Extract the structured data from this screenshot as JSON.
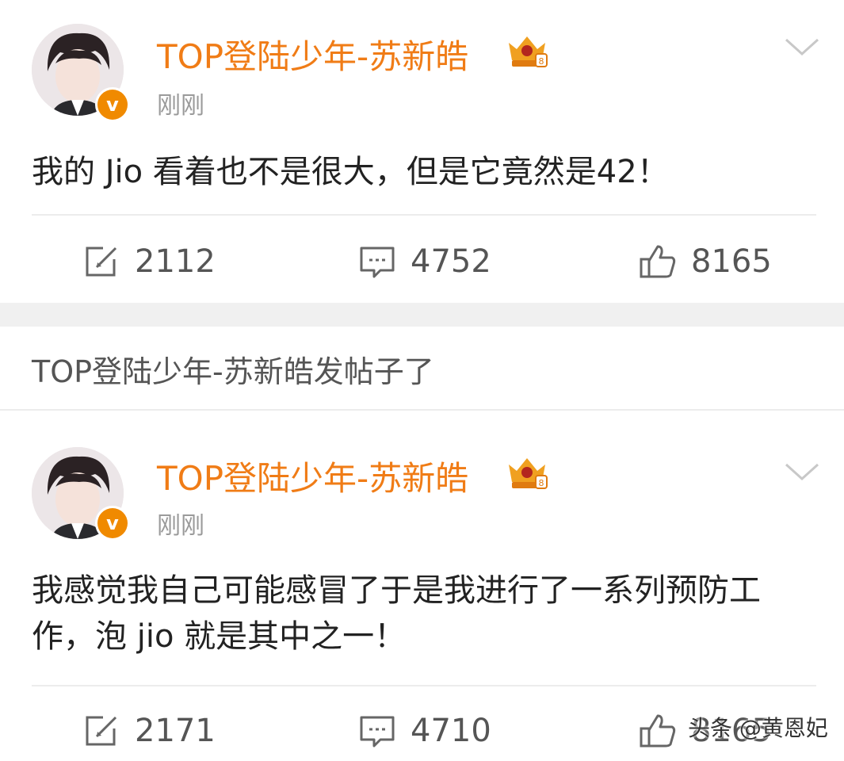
{
  "posts": [
    {
      "username": "TOP登陆少年-苏新皓",
      "verified_mark": "v",
      "time": "刚刚",
      "text": "我的 Jio 看着也不是很大，但是它竟然是42！",
      "reposts": "2112",
      "comments": "4752",
      "likes": "8165"
    },
    {
      "username": "TOP登陆少年-苏新皓",
      "verified_mark": "v",
      "time": "刚刚",
      "text": "我感觉我自己可能感冒了于是我进行了一系列预防工作，泡 jio 就是其中之一！",
      "reposts": "2171",
      "comments": "4710",
      "likes": "8165"
    }
  ],
  "repost_notice": "TOP登陆少年-苏新皓发帖子了",
  "watermark": "头条 @黄恩妃",
  "icons": {
    "repost": "repost-icon",
    "comment": "comment-icon",
    "like": "like-icon",
    "menu": "chevron-down-icon",
    "crown": "crown-badge-icon"
  },
  "colors": {
    "username": "#f07c16",
    "verified": "#f08a00",
    "meta": "#9a9a9a",
    "counter": "#555555",
    "separator": "#f0f0f0"
  }
}
